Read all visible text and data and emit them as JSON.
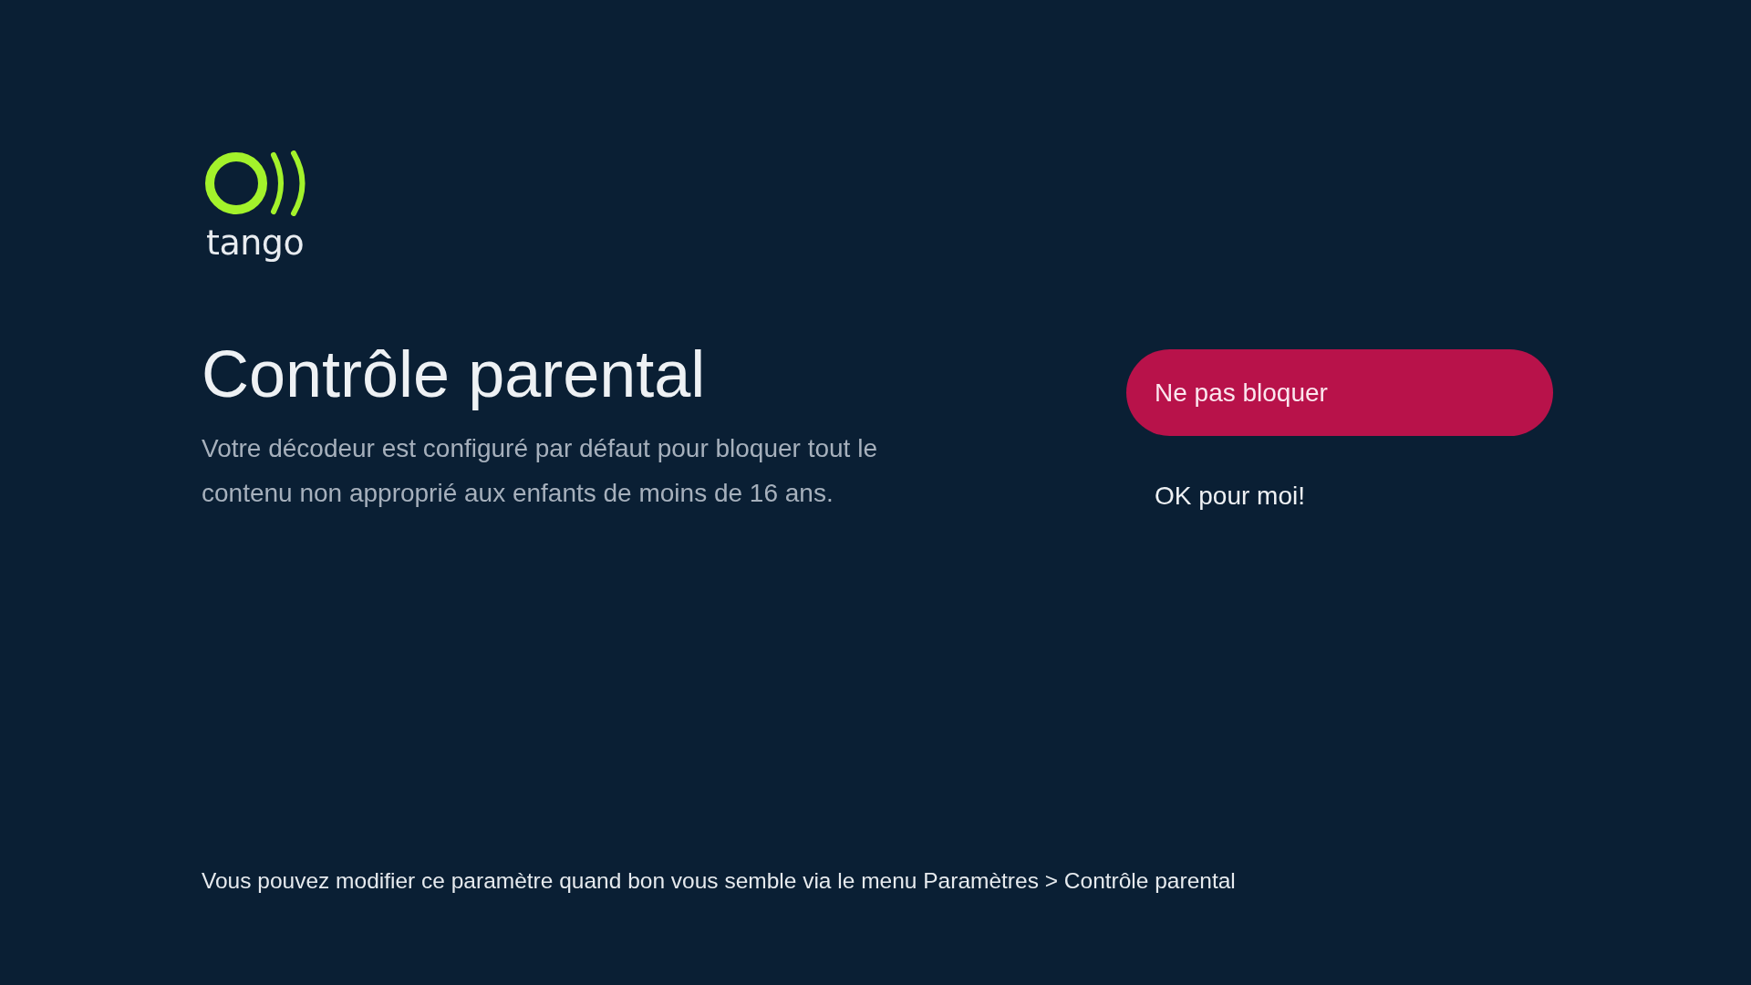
{
  "logo": {
    "wordmark": "tango"
  },
  "title": "Contrôle parental",
  "description": "Votre décodeur est configuré par défaut pour bloquer tout le contenu non approprié aux enfants de moins de 16 ans.",
  "options": [
    {
      "label": "Ne pas bloquer",
      "selected": true
    },
    {
      "label": "OK pour moi!",
      "selected": false
    }
  ],
  "footer_note": "Vous pouvez modifier ce paramètre quand bon vous semble via le menu Paramètres > Contrôle parental"
}
